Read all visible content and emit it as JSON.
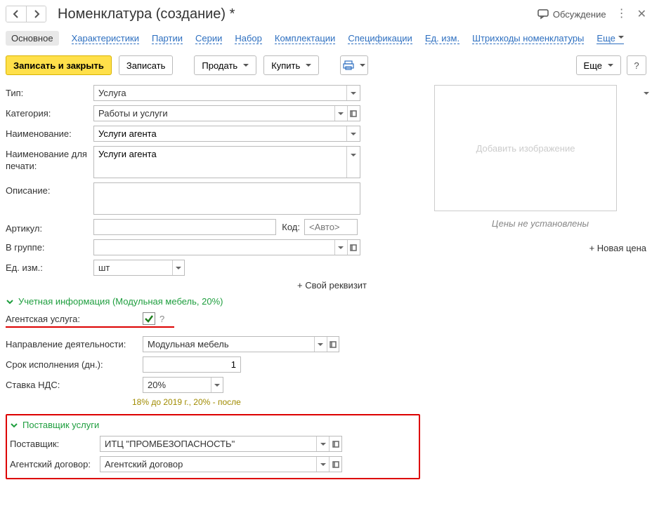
{
  "title": "Номенклатура (создание) *",
  "titlebar": {
    "discuss": "Обсуждение"
  },
  "tabs": {
    "main": "Основное",
    "items": [
      "Характеристики",
      "Партии",
      "Серии",
      "Набор",
      "Комплектации",
      "Спецификации",
      "Ед. изм.",
      "Штрихкоды номенклатуры"
    ],
    "more": "Еще"
  },
  "toolbar": {
    "save_close": "Записать и закрыть",
    "save": "Записать",
    "sell": "Продать",
    "buy": "Купить",
    "more": "Еще",
    "help": "?"
  },
  "labels": {
    "type": "Тип:",
    "category": "Категория:",
    "name": "Наименование:",
    "print_name": "Наименование для печати:",
    "descr": "Описание:",
    "article": "Артикул:",
    "code": "Код:",
    "group": "В группе:",
    "unit": "Ед. изм.:",
    "own_req": "+ Свой реквизит",
    "agent_service": "Агентская услуга:",
    "activity": "Направление деятельности:",
    "term": "Срок исполнения (дн.):",
    "vat": "Ставка НДС:",
    "supplier": "Поставщик:",
    "contract": "Агентский договор:"
  },
  "values": {
    "type": "Услуга",
    "category": "Работы и услуги",
    "name": "Услуги агента",
    "print_name": "Услуги агента",
    "descr": "",
    "article": "",
    "code_placeholder": "<Авто>",
    "group": "",
    "unit": "шт",
    "activity": "Модульная мебель",
    "term": "1",
    "vat": "20%",
    "vat_hint": "18% до 2019 г., 20% - после",
    "supplier": "ИТЦ \"ПРОМБЕЗОПАСНОСТЬ\"",
    "contract": "Агентский договор"
  },
  "sections": {
    "accounting": "Учетная информация (Модульная мебель, 20%)",
    "supplier": "Поставщик услуги"
  },
  "side": {
    "add_image": "Добавить изображение",
    "no_prices": "Цены не установлены",
    "new_price": "+ Новая цена"
  }
}
